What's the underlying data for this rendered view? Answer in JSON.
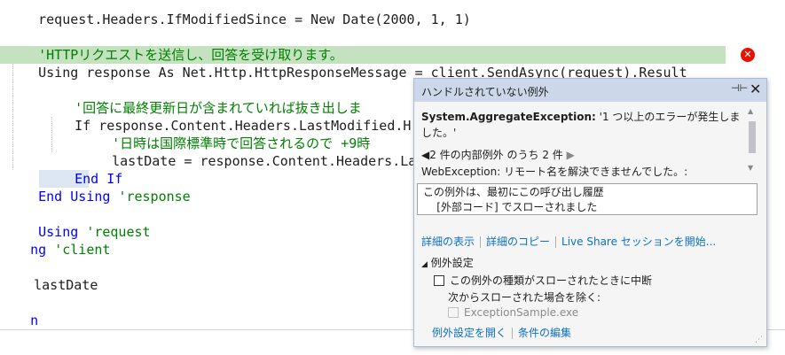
{
  "code": {
    "lines": [
      {
        "text": "request.Headers.IfModifiedSince = New Date(2000, 1, 1)"
      },
      {
        "text": "'HTTPリクエストを送信し、回答を受け取ります。"
      },
      {
        "text": "Using response As Net.Http.HttpResponseMessage = client.SendAsync(request).Result"
      },
      {
        "text": "'回答に最終更新日が含まれていれば抜き出しま"
      },
      {
        "text": "If response.Content.Headers.LastModified.H"
      },
      {
        "text": "'日時は国際標準時で回答されるので +9時"
      },
      {
        "text": "lastDate = response.Content.Headers.La"
      },
      {
        "text": "End If"
      },
      {
        "text": "End Using"
      },
      {
        "text": "'response"
      },
      {
        "text": "Using"
      },
      {
        "text": "'request"
      },
      {
        "text": "ng"
      },
      {
        "text": "'client"
      },
      {
        "text": "lastDate"
      },
      {
        "text": "n"
      }
    ]
  },
  "error_icon": "error-x-icon",
  "popup": {
    "title": "ハンドルされていない例外",
    "pin_icon": "pin-icon",
    "close_icon": "close-icon",
    "exception_type": "System.AggregateException:",
    "exception_message": " '1 つ以上のエラーが発生しました。'",
    "inner_label": "2 件の内部例外 のうち 2 件",
    "web_exception": "WebException: リモート名を解決できませんでした。:",
    "stack_line1": "この例外は、最初にこの呼び出し履歴",
    "stack_line2": "    [外部コード] でスローされました",
    "links": [
      "詳細の表示",
      "詳細のコピー",
      "Live Share セッションを開始..."
    ],
    "settings_header": "例外設定",
    "break_checkbox": "この例外の種類がスローされたときに中断",
    "except_label": "次からスローされた場合を除く:",
    "module_checkbox": "ExceptionSample.exe",
    "bottom_links": [
      "例外設定を開く",
      "条件の編集"
    ]
  }
}
